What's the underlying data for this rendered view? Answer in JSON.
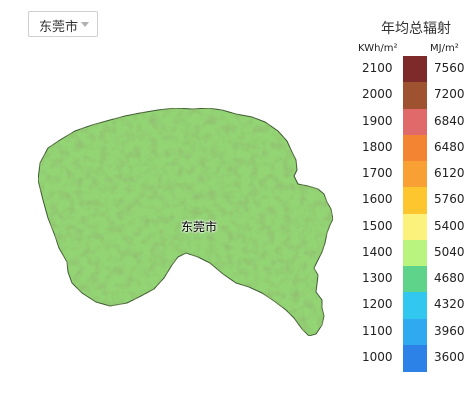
{
  "selector": {
    "value": "东莞市"
  },
  "map": {
    "region_label": "东莞市"
  },
  "legend": {
    "title": "年均总辐射",
    "unit_left": "KWh/m²",
    "unit_right": "MJ/m²",
    "classes": [
      {
        "kwh": "2100",
        "mj": "7560",
        "color": "#7f2a2a"
      },
      {
        "kwh": "2000",
        "mj": "7200",
        "color": "#9e522f"
      },
      {
        "kwh": "1900",
        "mj": "6840",
        "color": "#e06a6a"
      },
      {
        "kwh": "1800",
        "mj": "6480",
        "color": "#f38532"
      },
      {
        "kwh": "1700",
        "mj": "6120",
        "color": "#f8a033"
      },
      {
        "kwh": "1600",
        "mj": "5760",
        "color": "#fdc52e"
      },
      {
        "kwh": "1500",
        "mj": "5400",
        "color": "#fbf27c"
      },
      {
        "kwh": "1400",
        "mj": "5040",
        "color": "#b8f47e"
      },
      {
        "kwh": "1300",
        "mj": "4680",
        "color": "#5ed38a"
      },
      {
        "kwh": "1200",
        "mj": "4320",
        "color": "#32c7ef"
      },
      {
        "kwh": "1100",
        "mj": "3960",
        "color": "#2fa9ef"
      },
      {
        "kwh": "1000",
        "mj": "3600",
        "color": "#2d82e8"
      }
    ]
  },
  "colors": {
    "land": "#93d474",
    "terrain_dark": "#5f9e3c",
    "outline": "#3b5530"
  }
}
